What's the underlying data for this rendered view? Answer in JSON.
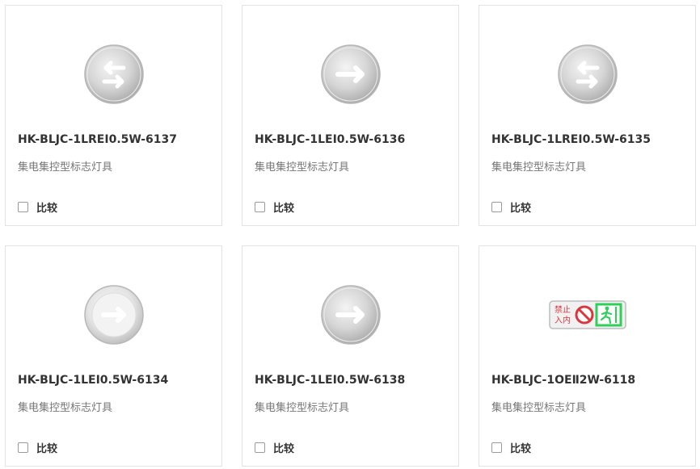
{
  "products": [
    {
      "model": "HK-BLJC-1LREⅠ0.5W-6137",
      "category": "集电集控型标志灯具",
      "compare_label": "比较",
      "icon": "double-arrow-icon"
    },
    {
      "model": "HK-BLJC-1LEⅠ0.5W-6136",
      "category": "集电集控型标志灯具",
      "compare_label": "比较",
      "icon": "right-arrow-icon"
    },
    {
      "model": "HK-BLJC-1LREⅠ0.5W-6135",
      "category": "集电集控型标志灯具",
      "compare_label": "比较",
      "icon": "double-arrow-icon"
    },
    {
      "model": "HK-BLJC-1LEⅠ0.5W-6134",
      "category": "集电集控型标志灯具",
      "compare_label": "比较",
      "icon": "right-arrow-icon"
    },
    {
      "model": "HK-BLJC-1LEⅠ0.5W-6138",
      "category": "集电集控型标志灯具",
      "compare_label": "比较",
      "icon": "right-arrow-icon"
    },
    {
      "model": "HK-BLJC-1OEⅡ2W-6118",
      "category": "集电集控型标志灯具",
      "compare_label": "比较",
      "icon": "no-entry-exit-sign-icon"
    }
  ],
  "sign_text": {
    "line1": "禁止",
    "line2": "入内"
  },
  "colors": {
    "border": "#e3e3e3",
    "title": "#333333",
    "subtitle": "#777777",
    "sign_red": "#d9363e",
    "sign_green": "#2fcf5a"
  }
}
